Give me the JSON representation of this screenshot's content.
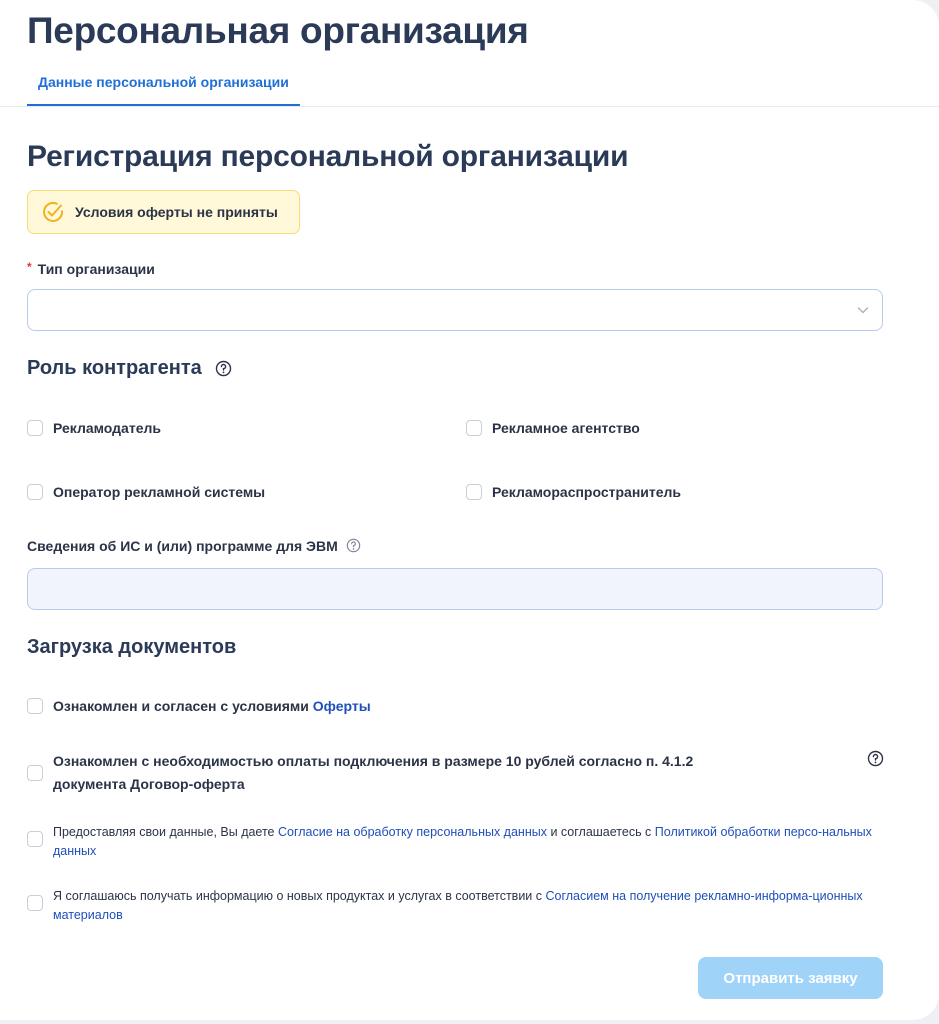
{
  "header": {
    "title": "Персональная организация",
    "tabs": [
      {
        "label": "Данные персональной организации",
        "active": true
      }
    ]
  },
  "form": {
    "title": "Регистрация персональной организации",
    "status": {
      "text": "Условия оферты не приняты",
      "icon": "check-circle-icon",
      "color": "#f2b21b"
    },
    "org_type": {
      "label": "Тип организации",
      "required_mark": "*",
      "value": ""
    },
    "role": {
      "title": "Роль контрагента",
      "options": [
        {
          "label": "Рекламодатель",
          "checked": false
        },
        {
          "label": "Рекламное агентство",
          "checked": false
        },
        {
          "label": "Оператор рекламной системы",
          "checked": false
        },
        {
          "label": "Рекламораспространитель",
          "checked": false
        }
      ]
    },
    "is_info": {
      "label": "Сведения об ИС и (или) программе для ЭВМ",
      "value": ""
    },
    "documents": {
      "title": "Загрузка документов",
      "offer": {
        "text": "Ознакомлен и согласен с условиями ",
        "link": "Оферты"
      },
      "payment": {
        "text": "Ознакомлен с необходимостью оплаты подключения в размере 10 рублей согласно п. 4.1.2 документа Договор-оферта"
      },
      "personal_data": {
        "text1": "Предоставляя свои данные, Вы даете ",
        "link1": "Согласие на обработку персональных данных",
        "text2": " и соглашаетесь с ",
        "link2": "Политикой обработки персо-нальных данных"
      },
      "marketing": {
        "text1": "Я соглашаюсь получать информацию о новых продуктах и услугах в соответствии с ",
        "link1": "Согласием на получение рекламно-информа-ционных материалов"
      }
    },
    "submit_label": "Отправить заявку"
  },
  "colors": {
    "accent": "#1f6fd6",
    "link": "#1f4fb8",
    "submit_disabled": "#9fd3f7",
    "badge_bg": "#fff8d9"
  }
}
